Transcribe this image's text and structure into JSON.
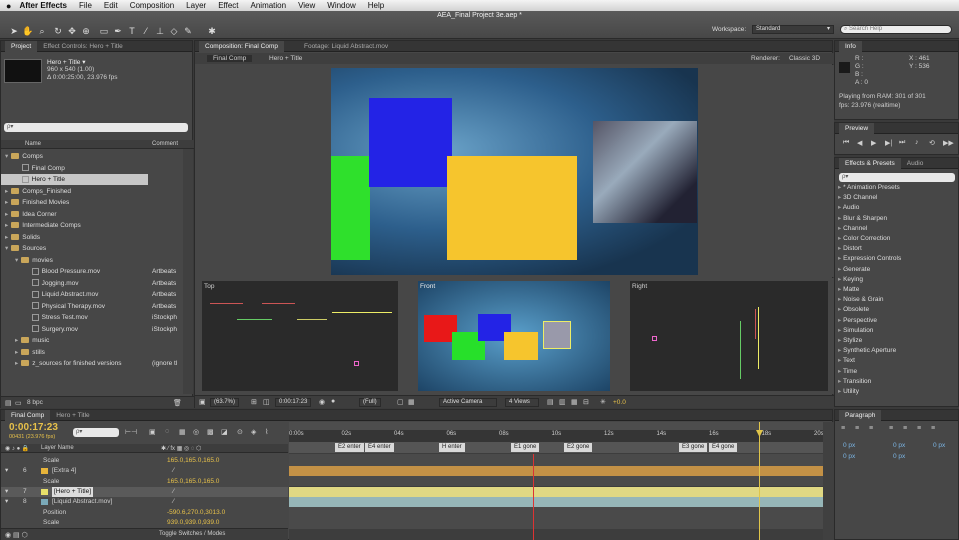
{
  "menu": {
    "apple": "",
    "app": "After Effects",
    "items": [
      "File",
      "Edit",
      "Composition",
      "Layer",
      "Effect",
      "Animation",
      "View",
      "Window",
      "Help"
    ]
  },
  "toolbar": {
    "title": "AEA_Final Project 3e.aep *",
    "workspace_label": "Workspace:",
    "workspace_value": "Standard",
    "search_placeholder": "Search Help"
  },
  "project": {
    "tab1": "Project",
    "tab2": "Effect Controls: Hero + Title",
    "name": "Hero + Title ▾",
    "dims": "960 x 540 (1.00)",
    "duration": "Δ 0:00:25:00, 23.976 fps",
    "search": "ρ▾",
    "col_name": "Name",
    "col_comment": "Comment",
    "bpc": "8 bpc",
    "rows": [
      {
        "t": "folder",
        "lvl": 0,
        "exp": "▾",
        "label": "Comps",
        "c": ""
      },
      {
        "t": "comp",
        "lvl": 1,
        "exp": "",
        "label": "Final Comp",
        "c": ""
      },
      {
        "t": "comp",
        "lvl": 1,
        "exp": "",
        "label": "Hero + Title",
        "c": "",
        "sel": true
      },
      {
        "t": "folder",
        "lvl": 0,
        "exp": "▸",
        "label": "Comps_Finished",
        "c": ""
      },
      {
        "t": "folder",
        "lvl": 0,
        "exp": "▸",
        "label": "Finished Movies",
        "c": ""
      },
      {
        "t": "folder",
        "lvl": 0,
        "exp": "▸",
        "label": "Idea Corner",
        "c": ""
      },
      {
        "t": "folder",
        "lvl": 0,
        "exp": "▸",
        "label": "Intermediate Comps",
        "c": ""
      },
      {
        "t": "folder",
        "lvl": 0,
        "exp": "▸",
        "label": "Solids",
        "c": ""
      },
      {
        "t": "folder",
        "lvl": 0,
        "exp": "▾",
        "label": "Sources",
        "c": ""
      },
      {
        "t": "folder",
        "lvl": 1,
        "exp": "▾",
        "label": "movies",
        "c": ""
      },
      {
        "t": "file",
        "lvl": 2,
        "exp": "",
        "label": "Blood Pressure.mov",
        "c": "Artbeats"
      },
      {
        "t": "file",
        "lvl": 2,
        "exp": "",
        "label": "Jogging.mov",
        "c": "Artbeats"
      },
      {
        "t": "file",
        "lvl": 2,
        "exp": "",
        "label": "Liquid Abstract.mov",
        "c": "Artbeats"
      },
      {
        "t": "file",
        "lvl": 2,
        "exp": "",
        "label": "Physical Therapy.mov",
        "c": "Artbeats"
      },
      {
        "t": "file",
        "lvl": 2,
        "exp": "",
        "label": "Stress Test.mov",
        "c": "iStockph"
      },
      {
        "t": "file",
        "lvl": 2,
        "exp": "",
        "label": "Surgery.mov",
        "c": "iStockph"
      },
      {
        "t": "folder",
        "lvl": 1,
        "exp": "▸",
        "label": "music",
        "c": ""
      },
      {
        "t": "folder",
        "lvl": 1,
        "exp": "▸",
        "label": "stills",
        "c": ""
      },
      {
        "t": "folder",
        "lvl": 1,
        "exp": "▸",
        "label": "z_sources for finished versions",
        "c": "(ignore tl"
      }
    ]
  },
  "comp": {
    "tab": "Composition: Final Comp",
    "tab2": "Footage: Liquid Abstract.mov",
    "crumb1": "Final Comp",
    "crumb2": "Hero + Title",
    "renderer_label": "Renderer:",
    "renderer": "Classic 3D",
    "view_top": "Top",
    "view_front": "Front",
    "view_right": "Right",
    "zoom": "(63.7%)",
    "time": "0:00:17:23",
    "res": "(Full)",
    "camera": "Active Camera",
    "views": "4 Views",
    "exposure": "+0.0"
  },
  "info": {
    "tab": "Info",
    "r": "R :",
    "g": "G :",
    "b": "B :",
    "a": "A : 0",
    "x": "X : 461",
    "y": "Y : 536",
    "ram": "Playing from RAM: 301 of 301",
    "fps": "fps: 23.976 (realtime)"
  },
  "preview": {
    "tab": "Preview"
  },
  "effects": {
    "tab1": "Effects & Presets",
    "tab2": "Audio",
    "search": "ρ▾",
    "items": [
      "* Animation Presets",
      "3D Channel",
      "Audio",
      "Blur & Sharpen",
      "Channel",
      "Color Correction",
      "Distort",
      "Expression Controls",
      "Generate",
      "Keying",
      "Matte",
      "Noise & Grain",
      "Obsolete",
      "Perspective",
      "Simulation",
      "Stylize",
      "Synthetic Aperture",
      "Text",
      "Time",
      "Transition",
      "Utility"
    ]
  },
  "paragraph": {
    "tab": "Paragraph",
    "f1": "0 px",
    "f2": "0 px",
    "f3": "0 px",
    "f4": "0 px",
    "f5": "0 px"
  },
  "timeline": {
    "tab1": "Final Comp",
    "tab2": "Hero + Title",
    "time": "0:00:17:23",
    "frames": "00431 (23.976 fps)",
    "search": "ρ▾",
    "col_layer": "Layer Name",
    "toggle": "Toggle Switches / Modes",
    "ruler": [
      "0:00s",
      "02s",
      "04s",
      "06s",
      "08s",
      "10s",
      "12s",
      "14s",
      "16s",
      "18s",
      "20s"
    ],
    "markers": [
      "E2 enter",
      "E4 enter",
      "H enter",
      "E1 gone",
      "E2 gone",
      "E3 gone",
      "E4 gone"
    ],
    "layers": [
      {
        "num": "",
        "name": "Scale",
        "prop": true,
        "val": "165.0,165.0,165.0"
      },
      {
        "num": "6",
        "name": "[Extra 4]",
        "prop": false,
        "val": "",
        "color": "#e7b43a"
      },
      {
        "num": "",
        "name": "Scale",
        "prop": true,
        "val": "165.0,165.0,165.0"
      },
      {
        "num": "7",
        "name": "[Hero + Title]",
        "prop": false,
        "val": "",
        "color": "#e7e06a",
        "sel": true
      },
      {
        "num": "8",
        "name": "[Liquid Abstract.mov]",
        "prop": false,
        "val": "",
        "color": "#7aa9b8"
      },
      {
        "num": "",
        "name": "Position",
        "prop": true,
        "val": "-590.6,270.0,3013.0"
      },
      {
        "num": "",
        "name": "Scale",
        "prop": true,
        "val": "939.0,939.0,939.0"
      }
    ]
  }
}
